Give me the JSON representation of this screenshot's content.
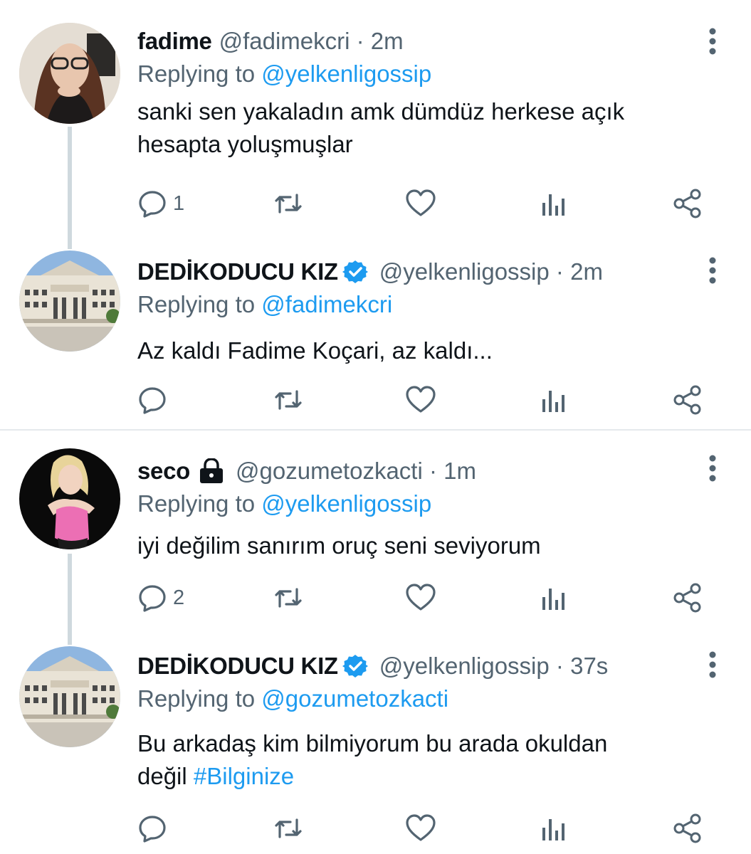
{
  "tweets": [
    {
      "name": "fadime",
      "handle": "@fadimekcri",
      "dot": "·",
      "time": "2m",
      "replying_prefix": "Replying to",
      "replying_to": "@yelkenligossip",
      "text_lines": [
        "sanki sen yakaladın amk dümdüz herkese açık",
        "hesapta yoluşmuşlar"
      ],
      "reply_count": "1",
      "verified": false,
      "locked": false
    },
    {
      "name": "DEDİKODUCU KIZ",
      "handle": "@yelkenligossip",
      "dot": "·",
      "time": "2m",
      "replying_prefix": "Replying to",
      "replying_to": "@fadimekcri",
      "text_lines": [
        "Az kaldı Fadime Koçari, az kaldı..."
      ],
      "reply_count": "",
      "verified": true,
      "locked": false
    },
    {
      "name": "seco",
      "handle": "@gozumetozkacti",
      "dot": "·",
      "time": "1m",
      "replying_prefix": "Replying to",
      "replying_to": "@yelkenligossip",
      "text_lines": [
        "iyi değilim sanırım oruç seni seviyorum"
      ],
      "reply_count": "2",
      "verified": false,
      "locked": true
    },
    {
      "name": "DEDİKODUCU KIZ",
      "handle": "@yelkenligossip",
      "dot": "·",
      "time": "37s",
      "replying_prefix": "Replying to",
      "replying_to": "@gozumetozkacti",
      "text_line1": "Bu arkadaş kim bilmiyorum bu arada okuldan",
      "text_line2_plain": "değil",
      "text_line2_hashtag": "#Bilginize",
      "reply_count": "",
      "verified": true,
      "locked": false
    }
  ],
  "colors": {
    "link": "#1d9bf0",
    "secondary_text": "#536471",
    "primary_text": "#0f1419",
    "thread_line": "#cfd9de"
  },
  "icons": [
    "reply-icon",
    "retweet-icon",
    "like-icon",
    "analytics-icon",
    "share-icon",
    "more-options-icon",
    "verified-badge-icon",
    "lock-icon"
  ]
}
